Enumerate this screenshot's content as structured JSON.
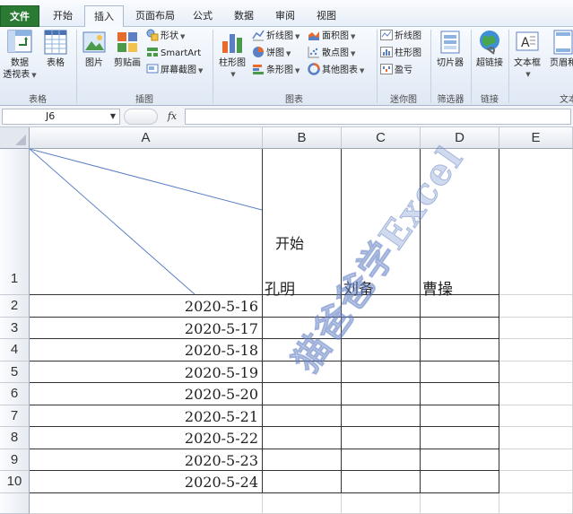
{
  "tabs": [
    {
      "id": "file",
      "label": "文件"
    },
    {
      "id": "home",
      "label": "开始"
    },
    {
      "id": "insert",
      "label": "插入"
    },
    {
      "id": "page_layout",
      "label": "页面布局"
    },
    {
      "id": "formulas",
      "label": "公式"
    },
    {
      "id": "data",
      "label": "数据"
    },
    {
      "id": "review",
      "label": "审阅"
    },
    {
      "id": "view",
      "label": "视图"
    }
  ],
  "active_tab": "插入",
  "ribbon": {
    "tables": {
      "group": "表格",
      "pivot_l1": "数据",
      "pivot_l2": "透视表",
      "table": "表格"
    },
    "illustrations": {
      "group": "插图",
      "picture": "图片",
      "clipart": "剪贴画",
      "shapes": "形状",
      "smartart": "SmartArt",
      "screenshot": "屏幕截图"
    },
    "charts": {
      "group": "图表",
      "column": "柱形图",
      "line": "折线图",
      "pie": "饼图",
      "bar": "条形图",
      "area": "面积图",
      "scatter": "散点图",
      "other": "其他图表"
    },
    "sparklines": {
      "group": "迷你图",
      "line": "折线图",
      "column": "柱形图",
      "winloss": "盈亏"
    },
    "filter": {
      "group": "筛选器",
      "slicer": "切片器"
    },
    "links": {
      "group": "链接",
      "hyperlink": "超链接"
    },
    "text": {
      "group": "文本",
      "textbox": "文本框",
      "header_footer": "页眉和"
    }
  },
  "formula_bar": {
    "name_box": "J6",
    "fx": "fx",
    "formula": ""
  },
  "columns": [
    "A",
    "B",
    "C",
    "D",
    "E"
  ],
  "rows": [
    "1",
    "2",
    "3",
    "4",
    "5",
    "6",
    "7",
    "8",
    "9",
    "10"
  ],
  "header_cell": {
    "top_right": "开始",
    "names": [
      "孔明",
      "刘备",
      "曹操"
    ]
  },
  "dates": [
    "2020-5-16",
    "2020-5-17",
    "2020-5-18",
    "2020-5-19",
    "2020-5-20",
    "2020-5-21",
    "2020-5-22",
    "2020-5-23",
    "2020-5-24"
  ],
  "watermark": "猫爸爸学Excel",
  "colors": {
    "file_tab": "#2b7a34",
    "diagonal_line": "#5b7fc4",
    "grid": "#d4d4d4",
    "border": "#333333"
  }
}
